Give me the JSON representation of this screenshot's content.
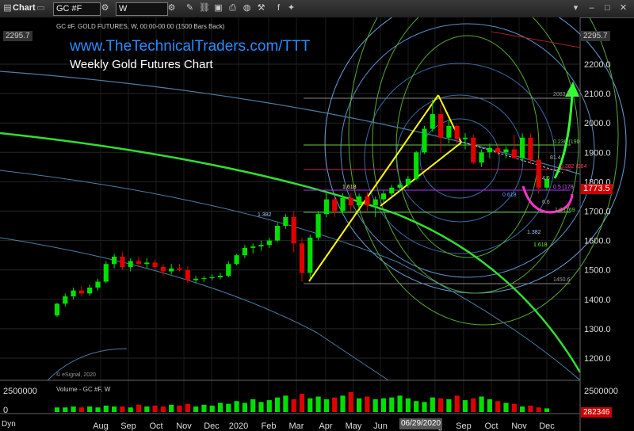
{
  "toolbar": {
    "chart_label": "Chart",
    "symbol": "GC #F",
    "interval": "W"
  },
  "header": {
    "symbol_line": "GC #F, GOLD FUTURES, W, 00:00-00:00 (1500 Bars Back)",
    "credit": "© eSignal, 2020"
  },
  "title": {
    "link": "www.TheTechnicalTraders.com/TTT",
    "subtitle": "Weekly Gold Futures Chart"
  },
  "volume": {
    "label": "Volume - GC #F, W",
    "axis_label": "2500000",
    "axis_zero": "0",
    "current": "282346"
  },
  "price_tags": {
    "last": "1773.5",
    "top": "2295.7"
  },
  "fib_labels": {
    "level_2083": "2083.4",
    "level_1450": "1450.6",
    "fib_1618_left": "1.618",
    "fib_1382_left": "1.382",
    "fib_0618": "0.618",
    "fib_1382_right": "1.382",
    "fib_1618_right": "1.618",
    "fib_0382": "0.382 (184",
    "fib_05": "0.5 (178",
    "fib_0236": "0.236 (190",
    "fib_level_81": "81.4",
    "fib_1_0": "1.0 (169",
    "fib_46": "4.6",
    "fib_6_6": "6.6"
  },
  "dyn_label": "Dyn",
  "date_marker": "06/29/2020",
  "colors": {
    "bull": "#00e000",
    "bear": "#e00000",
    "yellow": "#ffff00",
    "green_arc": "#66ff33",
    "magenta": "#ff33cc",
    "blue_text": "#2a8cff"
  },
  "chart_data": {
    "type": "candlestick",
    "ylim": [
      1100,
      2330
    ],
    "y_ticks": [
      1200.0,
      1300.0,
      1400.0,
      1500.0,
      1600.0,
      1700.0,
      1800.0,
      1900.0,
      2000.0,
      2100.0,
      2200.0
    ],
    "y_tick_labels": [
      "1200.0",
      "1300.0",
      "1400.0",
      "1500.0",
      "1600.0",
      "1700.0",
      "1800.0",
      "1900.0",
      "2000.0",
      "2100.0",
      "2200.0"
    ],
    "x_labels": [
      "Aug",
      "Sep",
      "Oct",
      "Nov",
      "Dec",
      "2020",
      "Feb",
      "Mar",
      "Apr",
      "May",
      "Jun",
      "Jul",
      "Aug",
      "Sep",
      "Oct",
      "Nov",
      "Dec"
    ],
    "candles": [
      [
        1345,
        1388,
        1340,
        1385
      ],
      [
        1385,
        1420,
        1375,
        1410
      ],
      [
        1410,
        1440,
        1400,
        1430
      ],
      [
        1430,
        1445,
        1410,
        1420
      ],
      [
        1420,
        1450,
        1412,
        1440
      ],
      [
        1440,
        1470,
        1430,
        1460
      ],
      [
        1460,
        1530,
        1455,
        1520
      ],
      [
        1520,
        1555,
        1505,
        1545
      ],
      [
        1545,
        1560,
        1500,
        1510
      ],
      [
        1510,
        1540,
        1495,
        1530
      ],
      [
        1530,
        1545,
        1510,
        1520
      ],
      [
        1520,
        1540,
        1505,
        1525
      ],
      [
        1525,
        1535,
        1500,
        1510
      ],
      [
        1510,
        1520,
        1480,
        1495
      ],
      [
        1495,
        1520,
        1485,
        1505
      ],
      [
        1505,
        1520,
        1495,
        1500
      ],
      [
        1500,
        1512,
        1455,
        1465
      ],
      [
        1465,
        1480,
        1455,
        1470
      ],
      [
        1470,
        1480,
        1460,
        1472
      ],
      [
        1472,
        1485,
        1465,
        1475
      ],
      [
        1475,
        1490,
        1468,
        1480
      ],
      [
        1480,
        1530,
        1475,
        1520
      ],
      [
        1520,
        1555,
        1515,
        1550
      ],
      [
        1550,
        1585,
        1540,
        1575
      ],
      [
        1575,
        1590,
        1555,
        1580
      ],
      [
        1580,
        1600,
        1565,
        1585
      ],
      [
        1585,
        1610,
        1575,
        1600
      ],
      [
        1600,
        1660,
        1595,
        1650
      ],
      [
        1650,
        1690,
        1640,
        1680
      ],
      [
        1680,
        1700,
        1560,
        1590
      ],
      [
        1590,
        1610,
        1460,
        1490
      ],
      [
        1490,
        1620,
        1470,
        1610
      ],
      [
        1610,
        1700,
        1600,
        1690
      ],
      [
        1690,
        1760,
        1680,
        1740
      ],
      [
        1740,
        1750,
        1680,
        1700
      ],
      [
        1700,
        1760,
        1690,
        1745
      ],
      [
        1745,
        1760,
        1700,
        1720
      ],
      [
        1720,
        1760,
        1710,
        1750
      ],
      [
        1750,
        1765,
        1700,
        1720
      ],
      [
        1720,
        1750,
        1680,
        1740
      ],
      [
        1740,
        1770,
        1730,
        1760
      ],
      [
        1760,
        1790,
        1750,
        1780
      ],
      [
        1780,
        1800,
        1765,
        1790
      ],
      [
        1790,
        1820,
        1780,
        1810
      ],
      [
        1810,
        1905,
        1805,
        1900
      ],
      [
        1900,
        1990,
        1895,
        1980
      ],
      [
        1980,
        2080,
        1970,
        2030
      ],
      [
        2030,
        2060,
        1900,
        1950
      ],
      [
        1950,
        2010,
        1930,
        1990
      ],
      [
        1990,
        1995,
        1930,
        1945
      ],
      [
        1945,
        1965,
        1910,
        1950
      ],
      [
        1950,
        1960,
        1860,
        1865
      ],
      [
        1865,
        1910,
        1850,
        1900
      ],
      [
        1900,
        1930,
        1880,
        1915
      ],
      [
        1915,
        1930,
        1890,
        1900
      ],
      [
        1900,
        1920,
        1880,
        1910
      ],
      [
        1910,
        1960,
        1880,
        1880
      ],
      [
        1880,
        1965,
        1870,
        1950
      ],
      [
        1950,
        1965,
        1860,
        1875
      ],
      [
        1875,
        1880,
        1760,
        1780
      ],
      [
        1780,
        1820,
        1770,
        1810
      ]
    ],
    "volumes": [
      0.05,
      0.05,
      0.06,
      0.05,
      0.06,
      0.05,
      0.07,
      0.06,
      0.06,
      0.05,
      0.08,
      0.06,
      0.07,
      0.06,
      0.08,
      0.07,
      0.09,
      0.06,
      0.08,
      0.07,
      0.1,
      0.09,
      0.12,
      0.1,
      0.14,
      0.11,
      0.13,
      0.16,
      0.18,
      0.14,
      0.2,
      0.15,
      0.17,
      0.14,
      0.16,
      0.18,
      0.22,
      0.15,
      0.17,
      0.14,
      0.15,
      0.16,
      0.18,
      0.15,
      0.12,
      0.11,
      0.16,
      0.15,
      0.14,
      0.18,
      0.13,
      0.15,
      0.17,
      0.14,
      0.12,
      0.1,
      0.09,
      0.06,
      0.07,
      0.05,
      0.04
    ]
  }
}
